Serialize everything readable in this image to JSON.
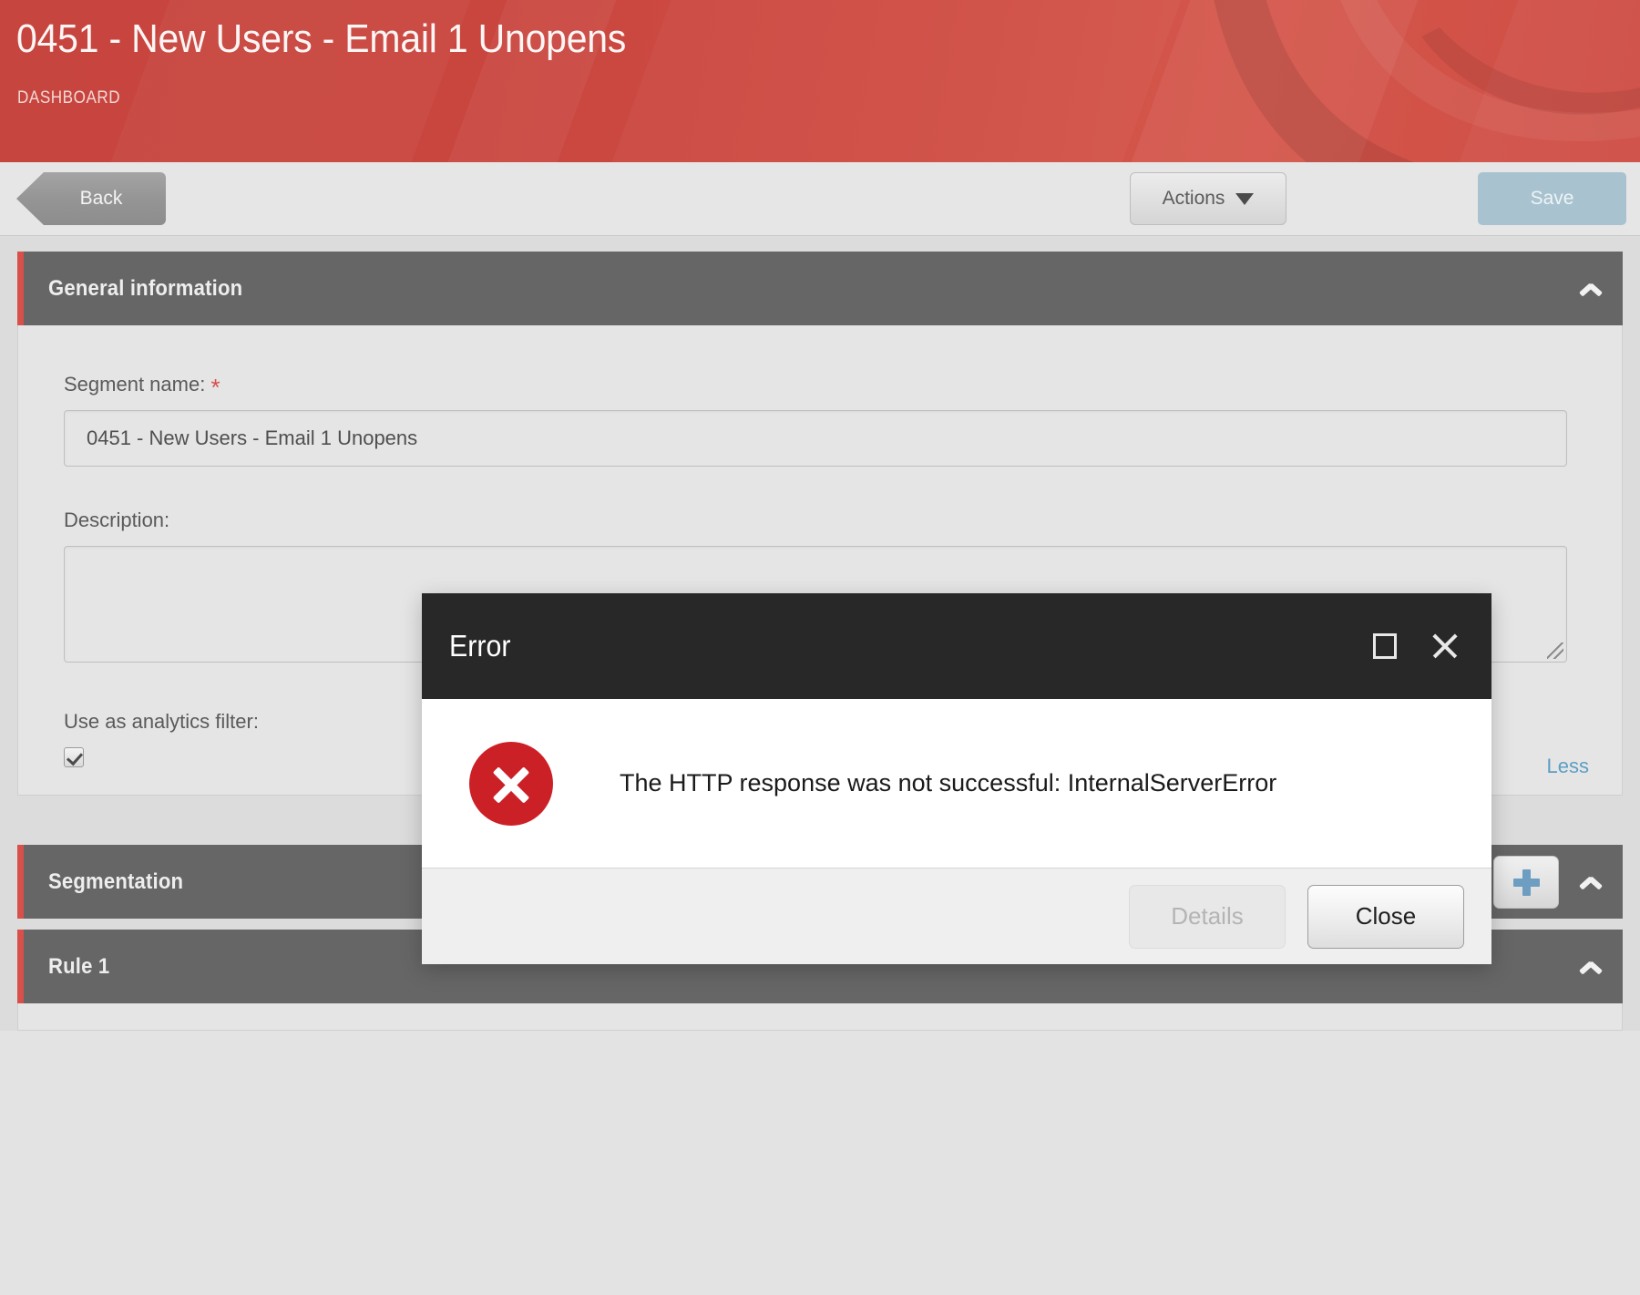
{
  "banner": {
    "title": "0451 - New Users - Email 1 Unopens",
    "subtitle": "DASHBOARD",
    "accent_color": "#c9463f"
  },
  "toolbar": {
    "back_label": "Back",
    "actions_label": "Actions",
    "actions_caret_icon": "chevron-down-icon",
    "save_label": "Save",
    "save_disabled_color": "#a8c3cf"
  },
  "sections": {
    "general": {
      "title": "General information",
      "collapse_icon": "chevron-up-icon",
      "accent_color": "#d8504a",
      "segment_name_label": "Segment name:",
      "segment_name_required_marker": "*",
      "segment_name_value": "0451 - New Users - Email 1 Unopens",
      "description_label": "Description:",
      "description_value": "",
      "analytics_filter_label": "Use as analytics filter:",
      "analytics_filter_checked": true,
      "less_link_label": "Less"
    },
    "segmentation": {
      "title": "Segmentation",
      "add_icon": "plus-icon",
      "collapse_icon": "chevron-up-icon"
    },
    "rule1": {
      "title": "Rule 1",
      "collapse_icon": "chevron-up-icon"
    }
  },
  "dialog": {
    "title": "Error",
    "maximize_icon": "maximize-icon",
    "close_icon": "close-icon",
    "status_icon": "error-circle-x-icon",
    "message": "The HTTP response was not successful: InternalServerError",
    "details_label": "Details",
    "details_disabled": true,
    "close_label": "Close",
    "error_color": "#cc2027"
  }
}
